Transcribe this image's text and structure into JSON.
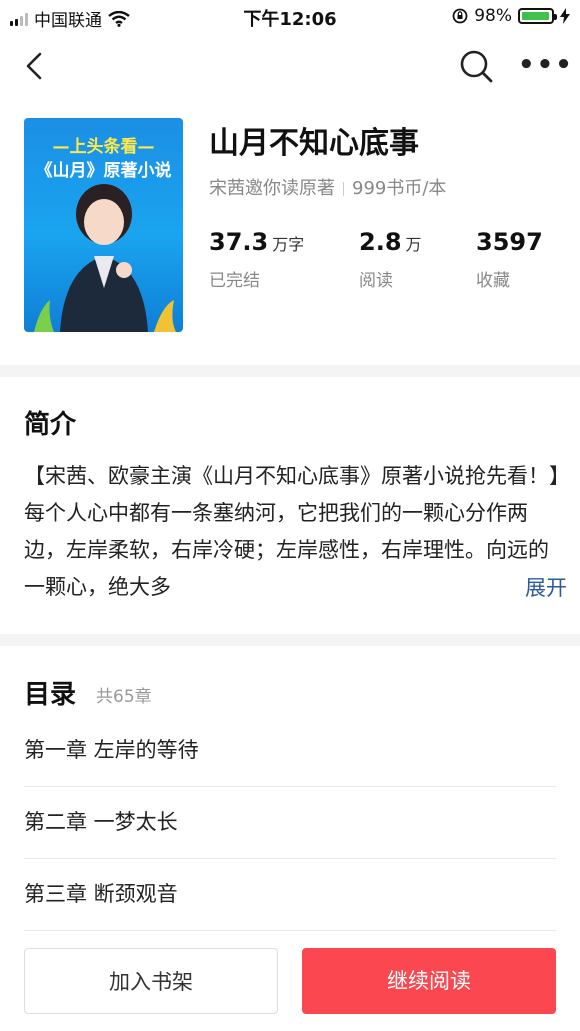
{
  "status_bar": {
    "carrier": "中国联通",
    "time": "下午12:06",
    "battery": "98%"
  },
  "nav": {
    "back_icon": "chevron-left-icon",
    "search_icon": "search-icon",
    "more_icon": "more-icon",
    "more_glyph": "•••"
  },
  "book": {
    "cover_line1": "—上头条看—",
    "cover_line2": "《山月》原著小说",
    "title": "山月不知心底事",
    "inviter": "宋茜邀你读原著",
    "price": "999书币/本",
    "stats": [
      {
        "num": "37.3",
        "unit": "万字",
        "label": "已完结"
      },
      {
        "num": "2.8",
        "unit": "万",
        "label": "阅读"
      },
      {
        "num": "3597",
        "unit": "",
        "label": "收藏"
      }
    ]
  },
  "intro": {
    "heading": "简介",
    "text": "【宋茜、欧豪主演《山月不知心底事》原著小说抢先看！】每个人心中都有一条塞纳河，它把我们的一颗心分作两边，左岸柔软，右岸冷硬；左岸感性，右岸理性。向远的一颗心，绝大多",
    "expand": "展开"
  },
  "toc": {
    "heading": "目录",
    "count": "共65章",
    "chapters": [
      "第一章 左岸的等待",
      "第二章 一梦太长",
      "第三章 断颈观音"
    ]
  },
  "actions": {
    "add_shelf": "加入书架",
    "continue_read": "继续阅读"
  },
  "colors": {
    "accent_red": "#fa4750",
    "link_blue": "#2c5aa0",
    "battery_green": "#3ec24a"
  }
}
